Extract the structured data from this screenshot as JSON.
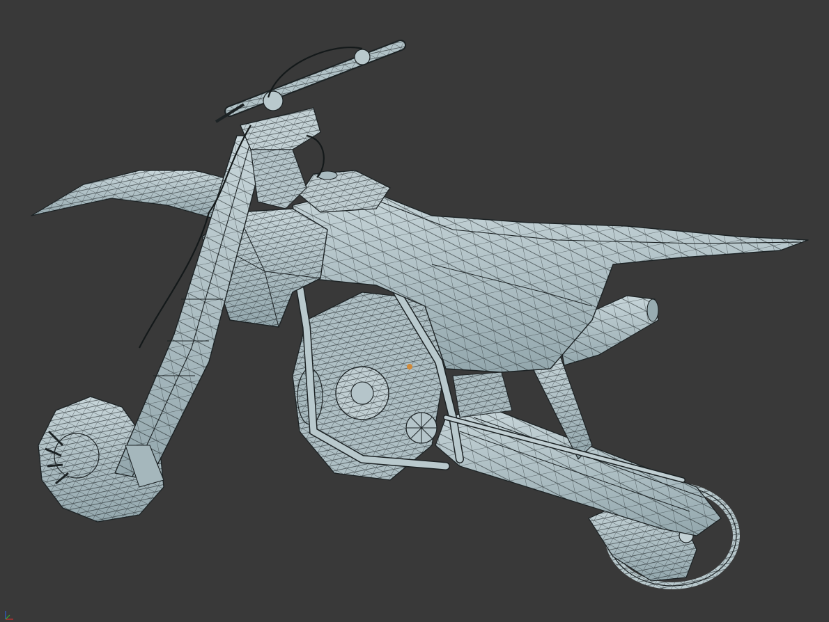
{
  "viewport": {
    "mode": "wireframe-on-shaded",
    "background_color": "#393939",
    "mesh_fill_color": "#b9c9cd",
    "mesh_shadow_color": "#8ea2a8",
    "wire_color": "#1c2224",
    "subject": "motocross-dirt-bike-3d-model"
  },
  "axis_gizmo": {
    "icon": "xyz-axis-icon",
    "x_color": "#d03030",
    "y_color": "#30b030",
    "z_color": "#3060d0"
  }
}
